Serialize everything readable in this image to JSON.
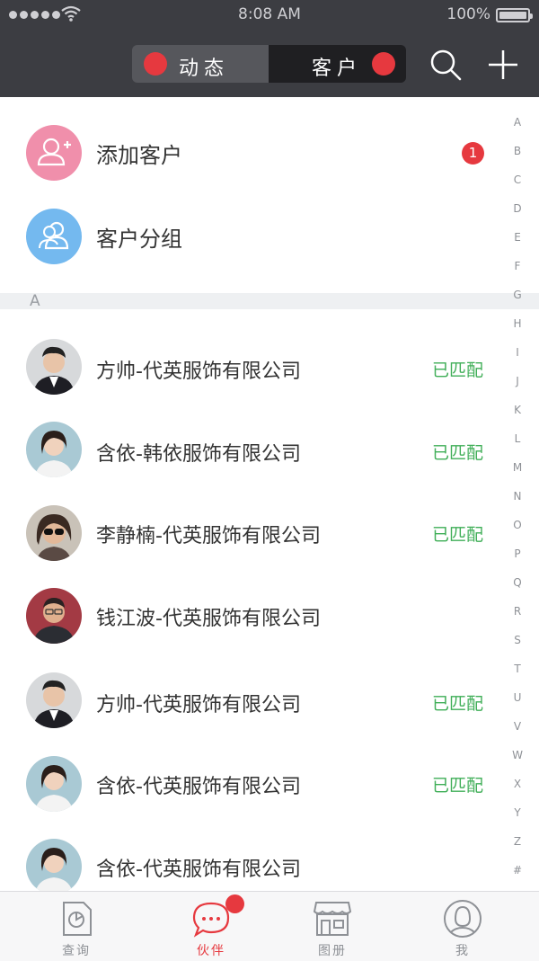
{
  "status_bar": {
    "time": "8:08 AM",
    "battery": "100%"
  },
  "nav": {
    "segment_left": "动态",
    "segment_right": "客户",
    "search_icon": "search-icon",
    "add_icon": "plus-icon"
  },
  "actions": {
    "add_customer": {
      "label": "添加客户",
      "badge": "1",
      "icon": "add-user-icon",
      "color": "#f08fab"
    },
    "customer_group": {
      "label": "客户分组",
      "icon": "user-group-icon",
      "color": "#74b9ef"
    }
  },
  "section_letter": "A",
  "contacts": [
    {
      "name": "方帅-代英服饰有限公司",
      "status": "已匹配"
    },
    {
      "name": "含依-韩依服饰有限公司",
      "status": "已匹配"
    },
    {
      "name": "李静楠-代英服饰有限公司",
      "status": "已匹配"
    },
    {
      "name": "钱江波-代英服饰有限公司",
      "status": ""
    },
    {
      "name": "方帅-代英服饰有限公司",
      "status": "已匹配"
    },
    {
      "name": "含依-代英服饰有限公司",
      "status": "已匹配"
    },
    {
      "name": "含依-代英服饰有限公司",
      "status": ""
    }
  ],
  "index_letters": [
    "A",
    "B",
    "C",
    "D",
    "E",
    "F",
    "G",
    "H",
    "I",
    "J",
    "K",
    "L",
    "M",
    "N",
    "O",
    "P",
    "Q",
    "R",
    "S",
    "T",
    "U",
    "V",
    "W",
    "X",
    "Y",
    "Z",
    "#"
  ],
  "tabbar": {
    "tabs": [
      {
        "label": "查询",
        "icon": "report-icon"
      },
      {
        "label": "伙伴",
        "icon": "chat-bubble-icon"
      },
      {
        "label": "图册",
        "icon": "store-icon"
      },
      {
        "label": "我",
        "icon": "profile-icon"
      }
    ],
    "active_index": 1
  },
  "colors": {
    "header_bg": "#3c3d42",
    "accent_red": "#e6393f",
    "matched_green": "#3fae57"
  }
}
